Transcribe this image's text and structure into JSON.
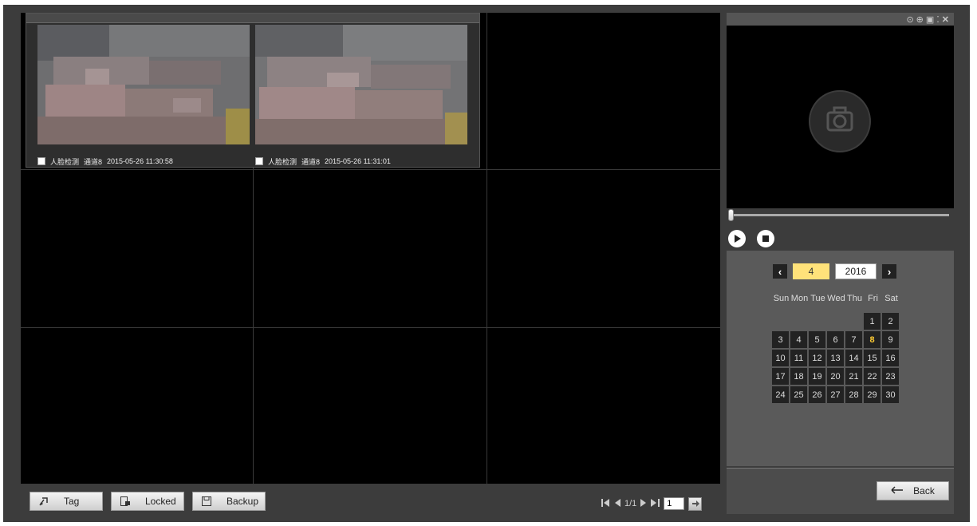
{
  "grid": {
    "snapshots": [
      {
        "event": "人脸检测",
        "channel": "通道8",
        "time": "2015-05-26 11:30:58"
      },
      {
        "event": "人脸检测",
        "channel": "通道8",
        "time": "2015-05-26 11:31:01"
      }
    ]
  },
  "toolbar": {
    "tag_label": "Tag",
    "locked_label": "Locked",
    "backup_label": "Backup"
  },
  "pager": {
    "page_info": "1/1",
    "page_input": "1"
  },
  "viewer": {
    "icons": [
      "eye-icon",
      "zoom-icon",
      "camera-icon",
      "grid-icon",
      "close-icon"
    ]
  },
  "calendar": {
    "month": "4",
    "year": "2016",
    "weekdays": [
      "Sun",
      "Mon",
      "Tue",
      "Wed",
      "Thu",
      "Fri",
      "Sat"
    ],
    "today": "8",
    "days": [
      "",
      "",
      "",
      "",
      "",
      "1",
      "2",
      "3",
      "4",
      "5",
      "6",
      "7",
      "8",
      "9",
      "10",
      "11",
      "12",
      "13",
      "14",
      "15",
      "16",
      "17",
      "18",
      "19",
      "20",
      "21",
      "22",
      "23",
      "24",
      "25",
      "26",
      "27",
      "28",
      "29",
      "30"
    ],
    "highlight_color": "#ffe27a"
  },
  "footer": {
    "back_label": "Back"
  }
}
